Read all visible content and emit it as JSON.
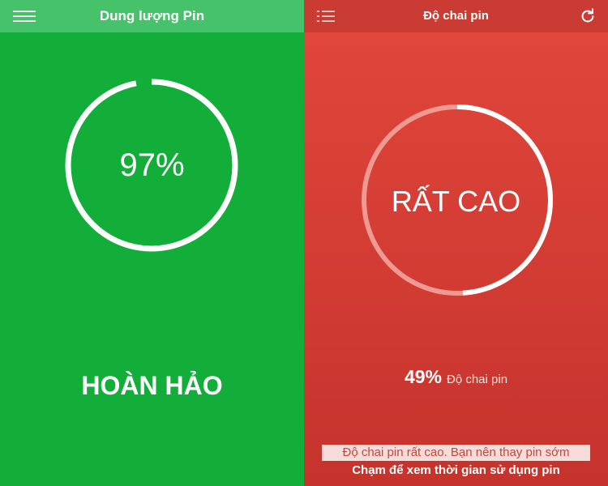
{
  "battery_capacity": {
    "title": "Dung lượng Pin",
    "percent_text": "97%",
    "percent_value": 0.97,
    "status": "HOÀN HẢO",
    "colors": {
      "background": "#13ad3a",
      "header": "#46c26b",
      "ring": "#ffffff"
    }
  },
  "battery_wear": {
    "title": "Độ chai pin",
    "level": "RẤT CAO",
    "wear_percent": "49%",
    "wear_value": 0.49,
    "wear_label": "Độ chai pin",
    "advice": "Độ chai pin rất cao. Bạn nên thay pin sớm",
    "cta": "Chạm để xem thời gian sử dụng pin",
    "colors": {
      "background": "#e2473c",
      "header": "#c93b33",
      "ring_fill": "#ffffff",
      "ring_track": "#ee9a92"
    }
  },
  "icons": {
    "menu": "hamburger-icon",
    "list": "list-icon",
    "refresh": "refresh-icon"
  }
}
